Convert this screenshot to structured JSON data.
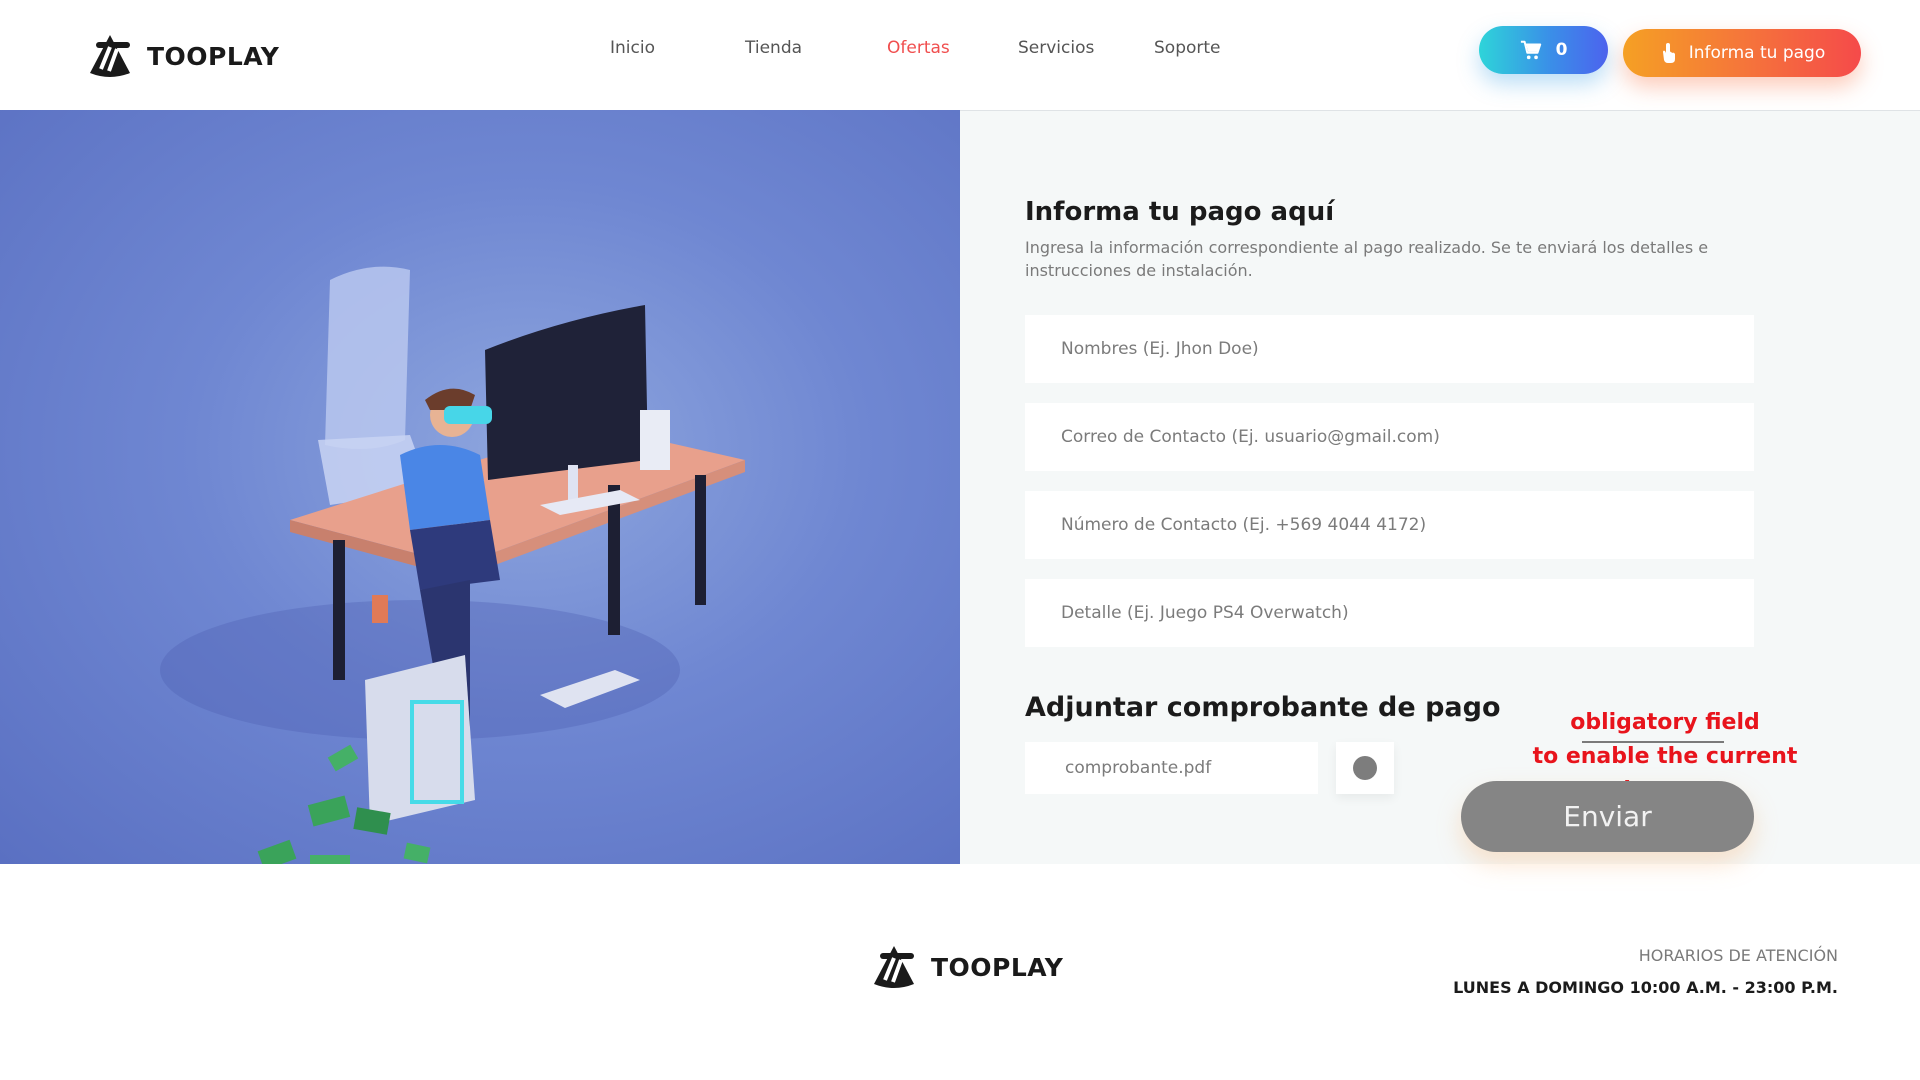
{
  "brand": {
    "name": "TOOPLAY"
  },
  "nav": {
    "items": [
      {
        "label": "Inicio",
        "active": false
      },
      {
        "label": "Tienda",
        "active": false
      },
      {
        "label": "Ofertas",
        "active": true
      },
      {
        "label": "Servicios",
        "active": false
      },
      {
        "label": "Soporte",
        "active": false
      }
    ]
  },
  "cart": {
    "count": "0",
    "icon": "cart-icon"
  },
  "pay_button": {
    "label": "Informa tu pago",
    "icon": "hand-pointer-icon"
  },
  "form": {
    "title": "Informa tu pago aquí",
    "subtitle": "Ingresa la información correspondiente al pago realizado. Se te enviará los detalles e instrucciones de instalación.",
    "fields": [
      {
        "name": "nombres",
        "placeholder": "Nombres (Ej. Jhon Doe)",
        "value": ""
      },
      {
        "name": "correo",
        "placeholder": "Correo de Contacto (Ej. usuario@gmail.com)",
        "value": ""
      },
      {
        "name": "telefono",
        "placeholder": "Número de Contacto (Ej. +569 4044 4172)",
        "value": ""
      },
      {
        "name": "detalle",
        "placeholder": "Detalle (Ej. Juego PS4 Overwatch)",
        "value": ""
      }
    ],
    "attach_title": "Adjuntar comprobante de pago",
    "file_name": "comprobante.pdf",
    "submit_label": "Enviar",
    "submit_enabled": false
  },
  "annotation": {
    "line1": "obligatory field",
    "line2": "to enable the current button"
  },
  "footer": {
    "hours_label": "HORARIOS DE ATENCIÓN",
    "hours_value": "LUNES A DOMINGO 10:00 A.M. - 23:00 P.M."
  },
  "colors": {
    "accent_red": "#f04e4e",
    "cart_gradient": [
      "#2ed4d9",
      "#4c63ee"
    ],
    "pay_gradient": [
      "#f5a024",
      "#f54a4a"
    ],
    "hero_blue": "#6f87d2",
    "disabled_button": "#858585",
    "annotation_red": "#e8141c"
  }
}
